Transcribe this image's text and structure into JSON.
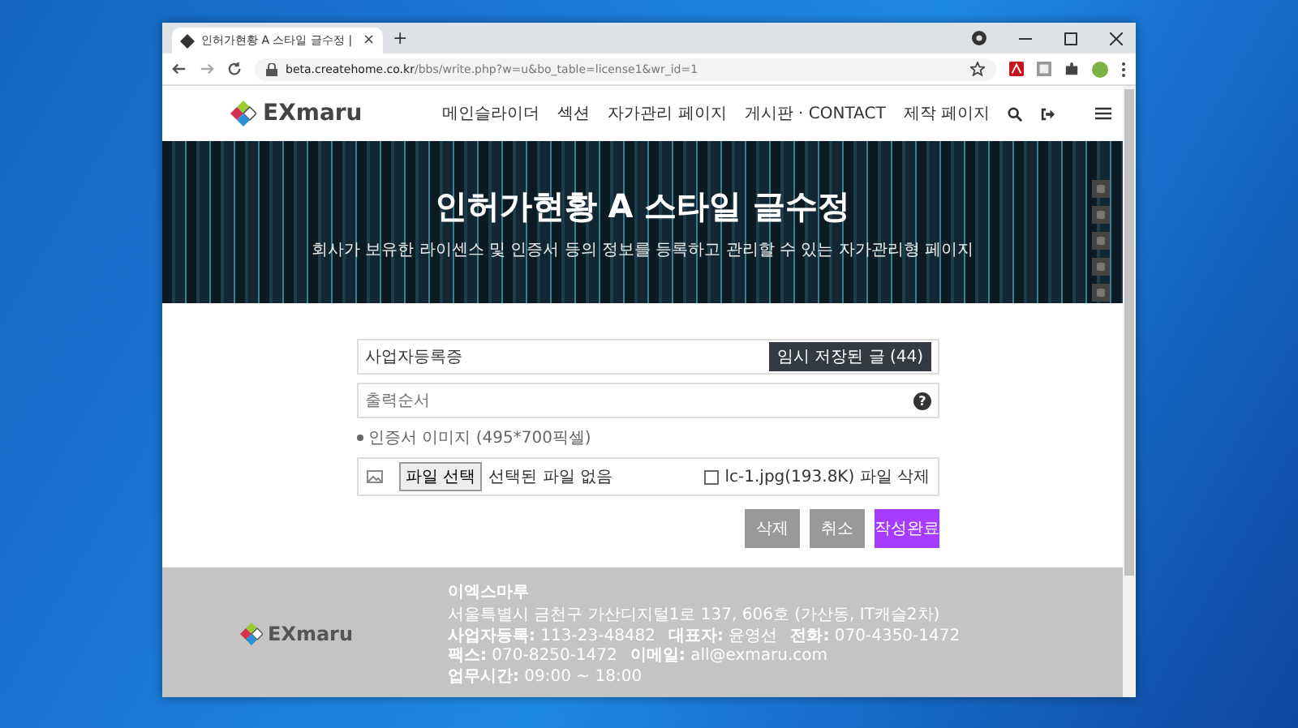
{
  "browser": {
    "tab_title": "인허가현황 A 스타일 글수정 |",
    "tab_close": "×",
    "new_tab": "+",
    "url_host": "beta.createhome.co.kr",
    "url_path": "/bbs/write.php?w=u&bo_table=license1&wr_id=1"
  },
  "header": {
    "logo": "EXmaru",
    "nav": [
      "메인슬라이더",
      "섹션",
      "자가관리 페이지",
      "게시판 · CONTACT",
      "제작 페이지"
    ]
  },
  "hero": {
    "title": "인허가현황 A 스타일 글수정",
    "subtitle": "회사가 보유한 라이센스 및 인증서 등의 정보를 등록하고 관리할 수 있는 자가관리형 페이지"
  },
  "form": {
    "subject": {
      "value": "사업자등록증"
    },
    "temp_button": "임시 저장된 글 (44)",
    "order": {
      "placeholder": "출력순서"
    },
    "help": "?",
    "image_label": "인증서 이미지 (495*700픽셀)",
    "file_button": "파일 선택",
    "file_status": "선택된 파일 없음",
    "delete_file": {
      "label": "lc-1.jpg(193.8K) 파일 삭제",
      "checked": false
    },
    "buttons": [
      {
        "label": "삭제",
        "kind": "delete"
      },
      {
        "label": "취소",
        "kind": "cancel"
      },
      {
        "label": "작성완료",
        "kind": "submit"
      }
    ]
  },
  "footer": {
    "logo": "EXmaru",
    "company": "이엑스마루",
    "address": "서울특별시 금천구 가산디지털1로 137, 606호 (가산동, IT캐슬2차)",
    "info": [
      {
        "label": "사업자등록:",
        "value": "113-23-48482"
      },
      {
        "label": "대표자:",
        "value": "윤영선"
      },
      {
        "label": "전화:",
        "value": "070-4350-1472"
      },
      {
        "label": "팩스:",
        "value": "070-8250-1472"
      },
      {
        "label": "이메일:",
        "value": "all@exmaru.com"
      }
    ],
    "hours": {
      "label": "업무시간:",
      "value": "09:00 ~ 18:00"
    }
  }
}
